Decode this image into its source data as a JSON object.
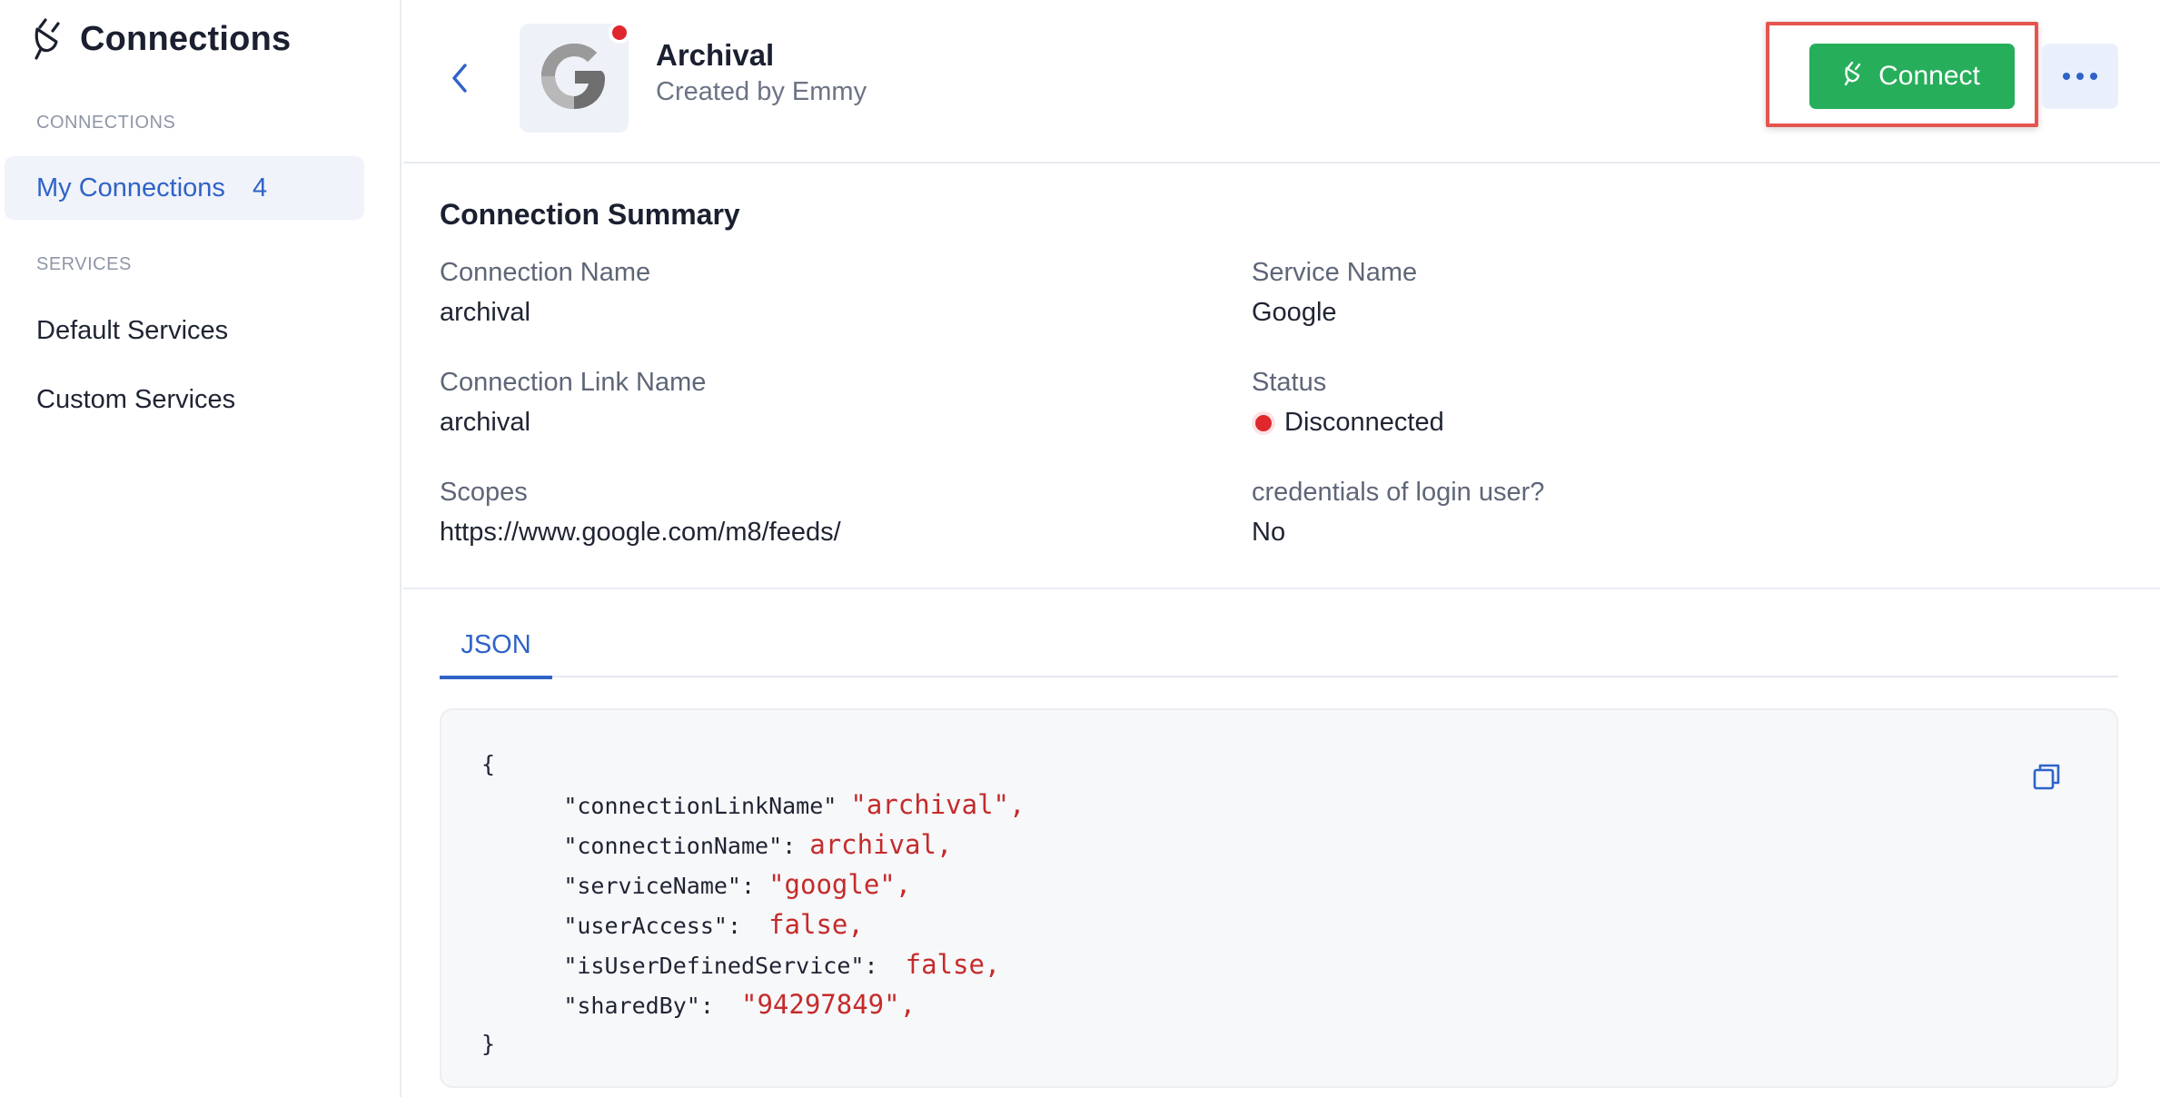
{
  "sidebar": {
    "brand_title": "Connections",
    "section_connections": "CONNECTIONS",
    "my_connections_label": "My Connections",
    "my_connections_count": "4",
    "section_services": "SERVICES",
    "default_services_label": "Default Services",
    "custom_services_label": "Custom Services"
  },
  "header": {
    "title": "Archival",
    "subtitle": "Created by Emmy",
    "connect_label": "Connect",
    "service_icon": "google-g-icon"
  },
  "summary": {
    "title": "Connection Summary",
    "fields": [
      {
        "label": "Connection Name",
        "value": "archival"
      },
      {
        "label": "Service Name",
        "value": "Google"
      },
      {
        "label": "Connection Link Name",
        "value": "archival"
      },
      {
        "label": "Status",
        "value": "Disconnected"
      },
      {
        "label": "Scopes",
        "value": "https://www.google.com/m8/feeds/"
      },
      {
        "label": "credentials of login user?",
        "value": "No"
      }
    ]
  },
  "json_tab": {
    "tab_label": "JSON",
    "open_brace": "{",
    "close_brace": "}",
    "lines": [
      {
        "key": "\"connectionLinkName\"",
        "sep": " ",
        "value": "\"archival\","
      },
      {
        "key": "\"connectionName\"",
        "sep": ": ",
        "value": "archival,"
      },
      {
        "key": "\"serviceName\"",
        "sep": ": ",
        "value": "\"google\","
      },
      {
        "key": "\"userAccess\"",
        "sep": ":  ",
        "value": "false,"
      },
      {
        "key": "\"isUserDefinedService\"",
        "sep": ":  ",
        "value": "false,"
      },
      {
        "key": "\"sharedBy\"",
        "sep": ":  ",
        "value": "\"94297849\","
      }
    ]
  },
  "colors": {
    "accent": "#2f63c8",
    "connect_green": "#27ae5b",
    "status_red": "#e0272e",
    "json_value_red": "#c52b2b",
    "highlight_border": "#e5554e"
  }
}
